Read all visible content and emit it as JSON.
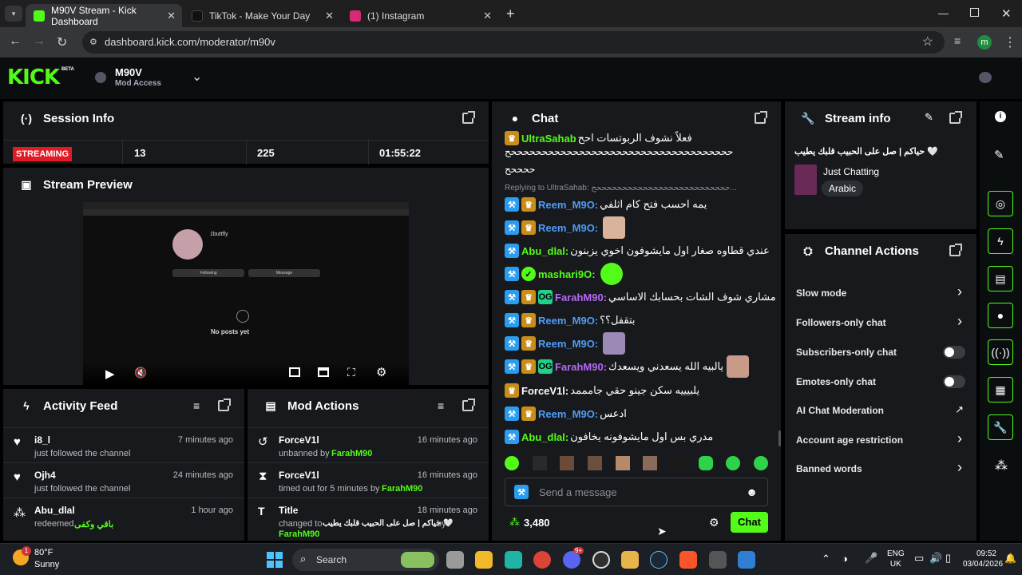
{
  "browser": {
    "tabs": [
      {
        "title": "M90V Stream - Kick Dashboard",
        "active": true,
        "favicon_color": "#53fc18"
      },
      {
        "title": "TikTok - Make Your Day",
        "active": false,
        "favicon_color": "#111111"
      },
      {
        "title": "(1) Instagram",
        "active": false,
        "favicon_color": "#d62976"
      }
    ],
    "url": "dashboard.kick.com/moderator/m90v",
    "profile_initial": "m"
  },
  "header": {
    "logo": "KICK",
    "logo_badge": "BETA",
    "channel_name": "M90V",
    "access": "Mod Access"
  },
  "session": {
    "title": "Session Info",
    "status": "STREAMING",
    "stats": [
      "13",
      "225",
      "01:55:22"
    ]
  },
  "preview": {
    "title": "Stream Preview",
    "inner_username": "1buttfly",
    "inner_no_posts": "No posts yet",
    "inner_following": "Following",
    "inner_message": "Message"
  },
  "activity": {
    "title": "Activity Feed",
    "items": [
      {
        "user": "i8_l",
        "time": "7 minutes ago",
        "action": "just followed the channel",
        "extra": ""
      },
      {
        "user": "Ojh4",
        "time": "24 minutes ago",
        "action": "just followed the channel",
        "extra": ""
      },
      {
        "user": "Abu_dlal",
        "time": "1 hour ago",
        "action": "redeemed",
        "extra": "باقي وكفى"
      }
    ]
  },
  "modactions": {
    "title": "Mod Actions",
    "items": [
      {
        "user": "ForceV1l",
        "time": "16 minutes ago",
        "action": "unbanned by",
        "by": "FarahM90"
      },
      {
        "user": "ForceV1l",
        "time": "16 minutes ago",
        "action": "timed out for 5 minutes by",
        "by": "FarahM90"
      },
      {
        "user": "Title",
        "time": "18 minutes ago",
        "action": "changed to",
        "detail": "حياكم | صل على الحبيب قلبك يطيب 🤍",
        "by_label": "by",
        "by": "FarahM90"
      }
    ]
  },
  "chat": {
    "title": "Chat",
    "top_partial_user": "UltraSahab",
    "top_partial_msg": "فعلاً نشوف الربوتسات احح",
    "top_line2": "ححححححححححححححححححححححححححححححححححححح",
    "top_line3": "ححححح",
    "reply_text": "Replying to UltraSahab: ححححححححححححححححححححححححححح...",
    "messages": [
      {
        "user": "Reem_M9O",
        "color": "#4f9df7",
        "msg": "يمه احسب فتح كام اثلفي"
      },
      {
        "user": "Reem_M9O",
        "color": "#4f9df7",
        "msg": ""
      },
      {
        "user": "Abu_dlal",
        "color": "#53fc18",
        "msg": "عندي قطاوه صغار اول مايشوفون اخوي يزبنون"
      },
      {
        "user": "mashari9O",
        "color": "#53fc18",
        "msg": ""
      },
      {
        "user": "FarahM90",
        "color": "#b46af5",
        "msg": "مشاري شوف الشات بحسابك الاساسي"
      },
      {
        "user": "Reem_M9O",
        "color": "#4f9df7",
        "msg": "بتقفل؟؟"
      },
      {
        "user": "Reem_M9O",
        "color": "#4f9df7",
        "msg": ""
      },
      {
        "user": "FarahM90",
        "color": "#b46af5",
        "msg": "يالبيه الله يسعدني ويسعدك"
      },
      {
        "user": "ForceV1l",
        "color": "#ffffff",
        "msg": "يلبيييه سكن جينو حقي جامممد"
      },
      {
        "user": "Reem_M9O",
        "color": "#4f9df7",
        "msg": "ادعس"
      },
      {
        "user": "Abu_dlal",
        "color": "#53fc18",
        "msg": "مدري بس اول مايشوفونه يخافون"
      }
    ],
    "input_placeholder": "Send a message",
    "points": "3,480",
    "send_label": "Chat"
  },
  "streaminfo": {
    "title": "Stream info",
    "stream_title": "حياكم | صل على الحبيب قلبك يطيب 🤍",
    "category": "Just Chatting",
    "tag": "Arabic"
  },
  "channelactions": {
    "title": "Channel Actions",
    "items": [
      {
        "label": "Slow mode",
        "type": "chevron"
      },
      {
        "label": "Followers-only chat",
        "type": "chevron"
      },
      {
        "label": "Subscribers-only chat",
        "type": "toggle"
      },
      {
        "label": "Emotes-only chat",
        "type": "toggle"
      },
      {
        "label": "AI Chat Moderation",
        "type": "external"
      },
      {
        "label": "Account age restriction",
        "type": "chevron"
      },
      {
        "label": "Banned words",
        "type": "chevron"
      }
    ]
  },
  "taskbar": {
    "weather_temp": "80°F",
    "weather_desc": "Sunny",
    "weather_badge": "1",
    "search": "Search",
    "lang1": "ENG",
    "lang2": "UK",
    "time": "09:52",
    "date": "03/04/2026",
    "discord_badge": "9+"
  },
  "colors": {
    "accent": "#53fc18",
    "streaming": "#e01b24",
    "panel": "#17191c"
  }
}
